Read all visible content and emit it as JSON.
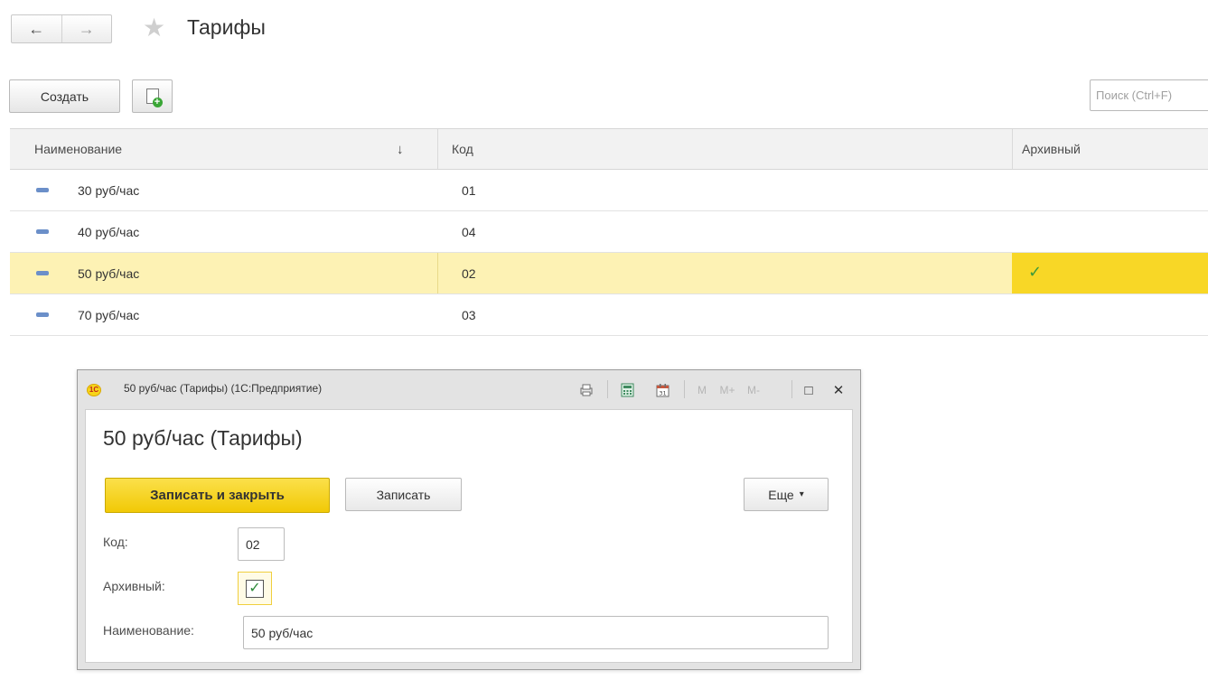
{
  "nav": {
    "back_label": "←",
    "forward_label": "→",
    "star_glyph": "★",
    "title": "Тарифы"
  },
  "toolbar": {
    "create_label": "Создать",
    "add_icon": "add-document-icon",
    "search_placeholder": "Поиск (Ctrl+F)"
  },
  "table": {
    "columns": [
      "Наименование",
      "Код",
      "Архивный"
    ],
    "sort_indicator": "↓",
    "rows": [
      {
        "name": "30 руб/час",
        "code": "01",
        "archived": false
      },
      {
        "name": "40 руб/час",
        "code": "04",
        "archived": false
      },
      {
        "name": "50 руб/час",
        "code": "02",
        "archived": true,
        "selected": true
      },
      {
        "name": "70 руб/час",
        "code": "03",
        "archived": false
      }
    ],
    "check_glyph": "✓"
  },
  "dialog": {
    "window_title": "50 руб/час (Тарифы)  (1С:Предприятие)",
    "logo_text": "1С",
    "toolbar_icons": [
      "print-icon",
      "calculator-icon",
      "calendar-icon"
    ],
    "memory_buttons": [
      "M",
      "M+",
      "M-"
    ],
    "maximize_glyph": "□",
    "close_glyph": "✕",
    "heading": "50 руб/час (Тарифы)",
    "save_close_label": "Записать и закрыть",
    "save_label": "Записать",
    "more_label": "Еще",
    "more_caret": "▾",
    "code_label": "Код:",
    "code_value": "02",
    "archived_label": "Архивный:",
    "archived_checked": true,
    "name_label": "Наименование:",
    "name_value": "50 руб/час"
  },
  "colors": {
    "accent_yellow": "#f8d726",
    "selected_row": "#fdf2b4",
    "check_green": "#3f9a3a"
  }
}
